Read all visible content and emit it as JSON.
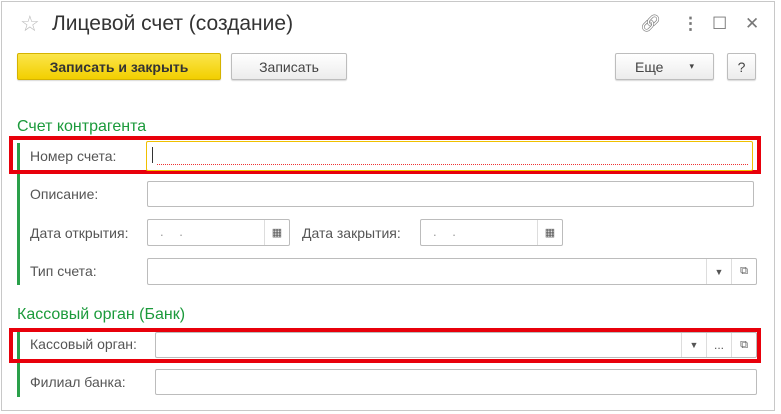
{
  "window": {
    "title": "Лицевой счет (создание)",
    "icons": [
      "star-icon",
      "link-icon",
      "more-icon",
      "maximize-icon",
      "close-icon"
    ]
  },
  "toolbar": {
    "save_close": "Записать и закрыть",
    "save": "Записать",
    "more": "Еще",
    "help": "?"
  },
  "section1": {
    "title": "Счет контрагента",
    "account_number": {
      "label": "Номер счета:",
      "value": ""
    },
    "description": {
      "label": "Описание:",
      "value": ""
    },
    "open_date": {
      "label": "Дата открытия:",
      "value": ". ."
    },
    "close_date": {
      "label": "Дата закрытия:",
      "value": ". ."
    },
    "account_type": {
      "label": "Тип счета:",
      "value": ""
    }
  },
  "section2": {
    "title": "Кассовый орган (Банк)",
    "cash_body": {
      "label": "Кассовый орган:",
      "value": "",
      "select_more": "..."
    },
    "bank_branch": {
      "label": "Филиал банка:",
      "value": ""
    }
  },
  "colors": {
    "accent_green": "#1b9a3b",
    "highlight_red": "#e8000b",
    "primary_yellow": "#f2cf00"
  }
}
